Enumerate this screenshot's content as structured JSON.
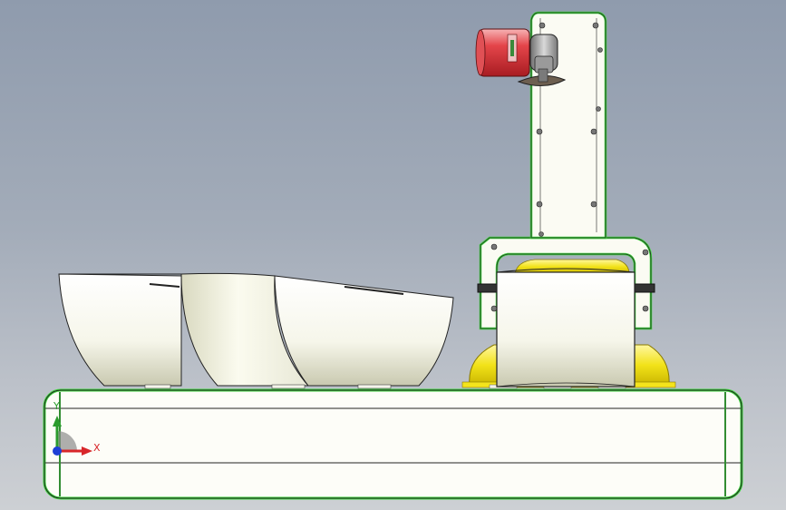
{
  "viewport": {
    "triad": {
      "x_label": "X",
      "y_label": "Y"
    }
  },
  "colors": {
    "background_top": "#8f9bad",
    "background_bottom": "#cdd0d4",
    "body_fill": "#fdfdf8",
    "edge_highlight": "#3cd43c",
    "yellow_part": "#f2e218",
    "red_cylinder": "#d83a3e",
    "axis_x": "#d8262a",
    "axis_y": "#2b9b2d",
    "axis_z": "#1d3fd6"
  },
  "icons": {
    "view_triad": "coordinate-triad-icon"
  }
}
